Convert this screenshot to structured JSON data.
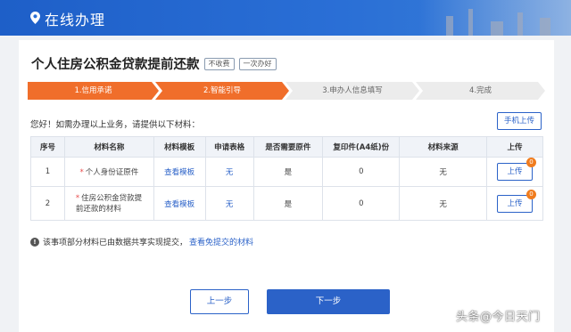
{
  "header": {
    "title": "在线办理",
    "icon": "location-pin-icon"
  },
  "page": {
    "title": "个人住房公积金贷款提前还款",
    "tags": [
      "不收费",
      "一次办好"
    ]
  },
  "steps": [
    {
      "label": "1.信用承诺",
      "state": "done"
    },
    {
      "label": "2.智能引导",
      "state": "current"
    },
    {
      "label": "3.申办人信息填写",
      "state": "todo"
    },
    {
      "label": "4.完成",
      "state": "todo"
    }
  ],
  "greeting": "您好！如需办理以上业务，请提供以下材料：",
  "mobile_upload_label": "手机上传",
  "table": {
    "headers": [
      "序号",
      "材料名称",
      "材料模板",
      "申请表格",
      "是否需要原件",
      "复印件(A4纸)份",
      "材料来源",
      "上传"
    ],
    "rows": [
      {
        "index": "1",
        "required_mark": "*",
        "name": "个人身份证原件",
        "template": "查看模板",
        "form": "无",
        "original": "是",
        "copies": "0",
        "source": "无",
        "upload": "上传",
        "badge": "0"
      },
      {
        "index": "2",
        "required_mark": "*",
        "name": "住房公积金贷款提前还款的材料",
        "template": "查看模板",
        "form": "无",
        "original": "是",
        "copies": "0",
        "source": "无",
        "upload": "上传",
        "badge": "0"
      }
    ]
  },
  "notice": {
    "text": "该事项部分材料已由数据共享实现提交，",
    "link": "查看免提交的材料",
    "icon": "info-icon"
  },
  "buttons": {
    "prev": "上一步",
    "next": "下一步"
  },
  "watermark": "头条@今日天门",
  "colors": {
    "header_blue": "#2a6fd6",
    "step_active": "#f06e2b",
    "primary": "#2b62c8",
    "badge": "#f07c1e"
  }
}
